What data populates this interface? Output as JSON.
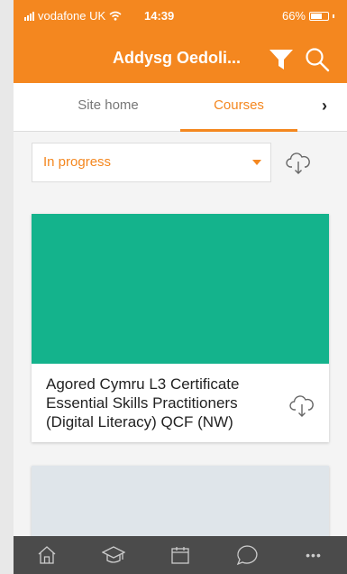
{
  "status_bar": {
    "carrier": "vodafone UK",
    "time": "14:39",
    "battery": "66%",
    "battery_level": 0.66
  },
  "header": {
    "title": "Addysg Oedoli...",
    "filter_icon": "filter-icon",
    "search_icon": "search-icon"
  },
  "tabs": {
    "items": [
      {
        "label": "Site home",
        "active": false
      },
      {
        "label": "Courses",
        "active": true
      }
    ],
    "next_label": "›"
  },
  "filter": {
    "selected": "In progress",
    "download_icon": "cloud-download-icon"
  },
  "courses": [
    {
      "name": "Agored Cymru L3 Certificate Essential Skills Practitioners (Digital Literacy) QCF (NW)",
      "image_color": "#14b38c"
    },
    {
      "name": "",
      "image_color": "#dfe5ea"
    }
  ],
  "bottom_nav": {
    "items": [
      "home-icon",
      "graduation-cap-icon",
      "calendar-icon",
      "chat-bubble-icon",
      "more-icon"
    ],
    "more_label": "•••"
  },
  "colors": {
    "accent": "#f4871f",
    "nav_bg": "#4b4b4b"
  }
}
